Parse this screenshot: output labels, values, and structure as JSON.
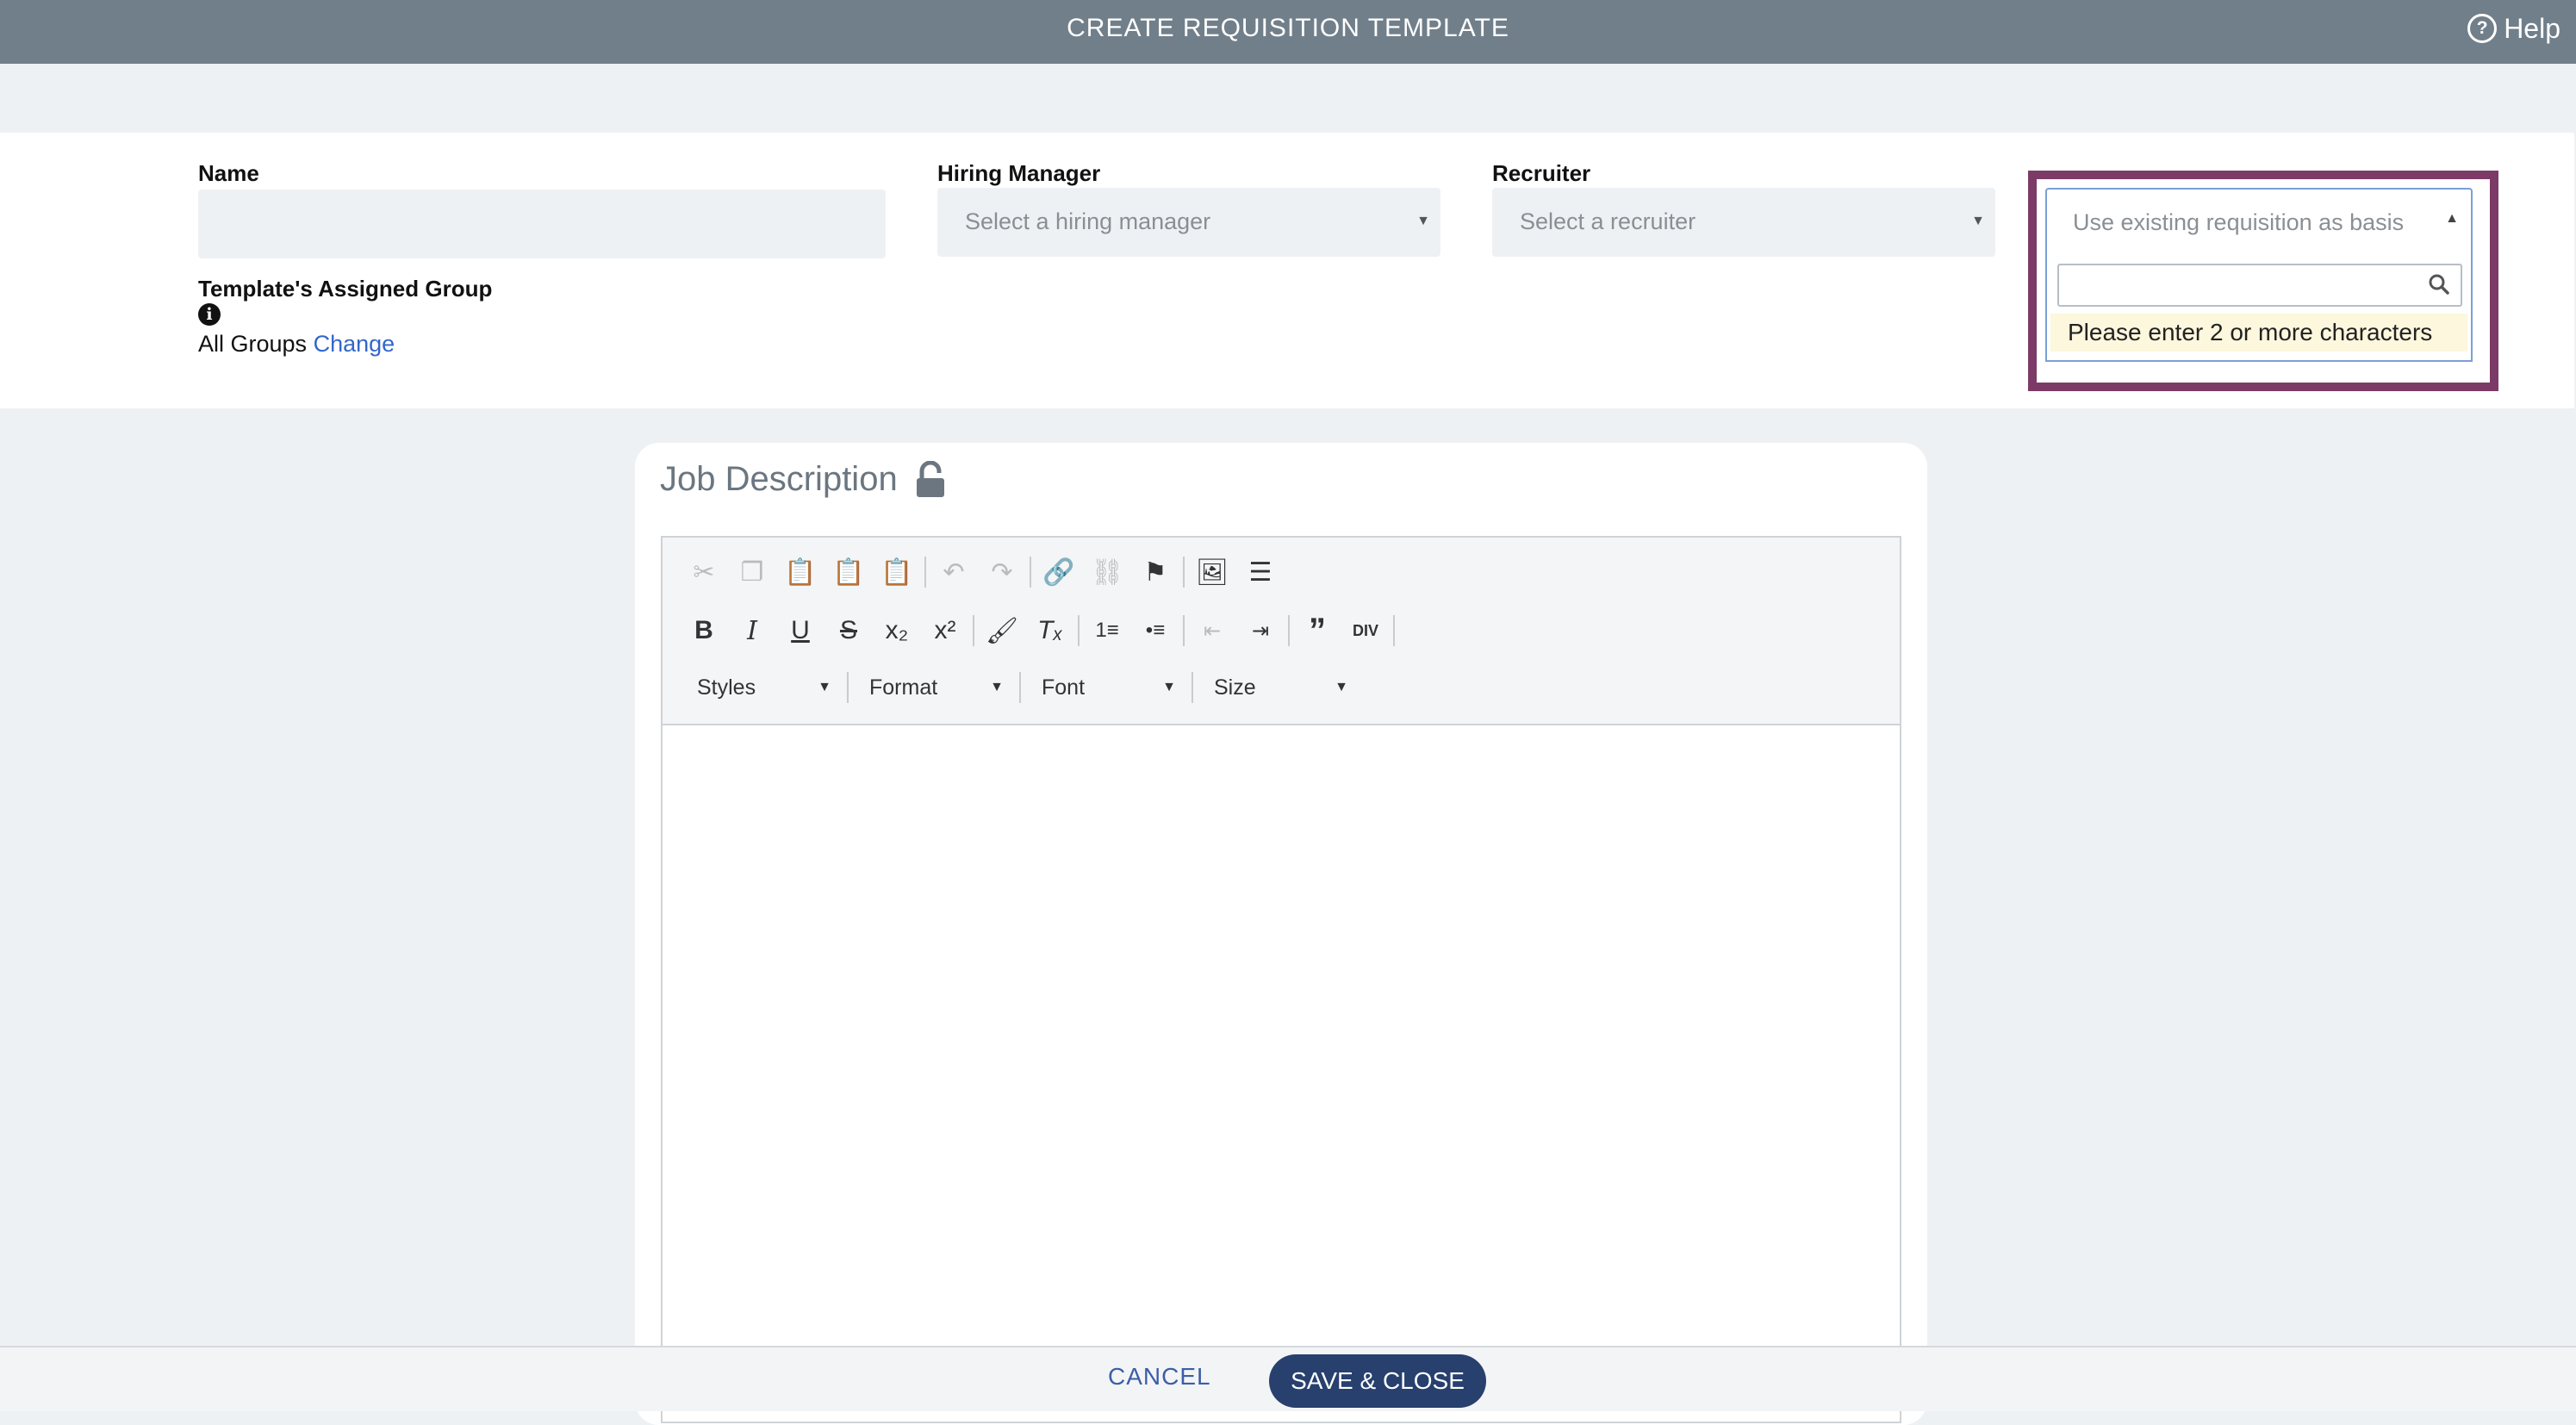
{
  "header": {
    "title": "CREATE REQUISITION TEMPLATE",
    "help_label": "Help"
  },
  "form": {
    "name_label": "Name",
    "name_value": "",
    "hiring_manager_label": "Hiring Manager",
    "hiring_manager_placeholder": "Select a hiring manager",
    "recruiter_label": "Recruiter",
    "recruiter_placeholder": "Select a recruiter",
    "group_label": "Template's Assigned Group",
    "group_value": "All Groups",
    "group_change_link": "Change"
  },
  "basis": {
    "placeholder": "Use existing requisition as basis",
    "search_value": "",
    "message": "Please enter 2 or more characters"
  },
  "job_description": {
    "title": "Job Description"
  },
  "toolbar": {
    "combos": [
      "Styles",
      "Format",
      "Font",
      "Size"
    ]
  },
  "footer": {
    "cancel_label": "CANCEL",
    "save_label": "SAVE & CLOSE"
  },
  "colors": {
    "header_bg": "#717f8a",
    "highlight": "#7c3b66",
    "primary": "#27406e",
    "link": "#3366cc"
  }
}
